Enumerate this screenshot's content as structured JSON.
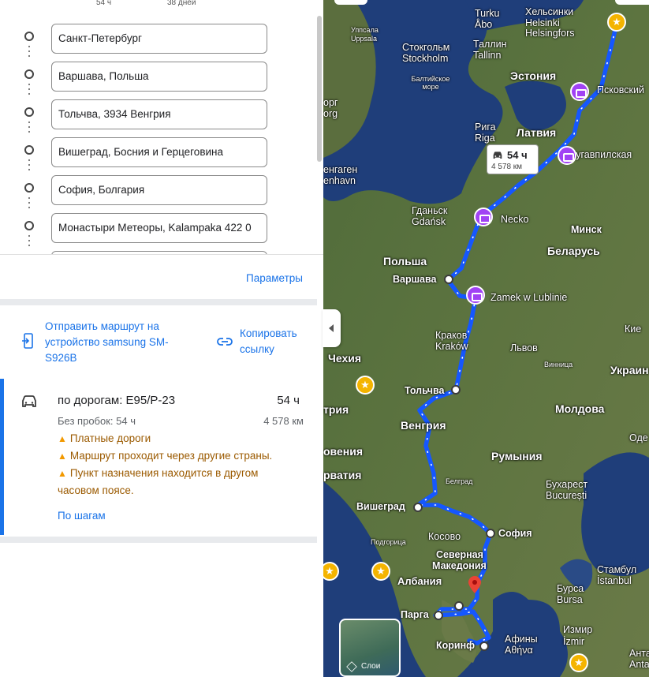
{
  "top_stats": {
    "duration": "54 ч",
    "days": "38 дней"
  },
  "stops": [
    "Санкт-Петербург",
    "Варшава, Польша",
    "Тольчва, 3934 Венгрия",
    "Вишеград, Босния и Герцеговина",
    "София, Болгария",
    "Монастыри Метеоры, Kalampaka 422 0"
  ],
  "parameters_link": "Параметры",
  "send_to_device": "Отправить маршрут на устройство samsung SM-S926B",
  "copy_link": "Копировать ссылку",
  "route": {
    "title": "по дорогам: E95/P-23",
    "duration": "54 ч",
    "traffic": "Без пробок: 54 ч",
    "distance": "4 578 км",
    "warnings": [
      "Платные дороги",
      "Маршрут проходит через другие страны.",
      "Пункт назначения находится в другом часовом поясе."
    ],
    "steps_link": "По шагам"
  },
  "map": {
    "bubble": {
      "time": "54 ч",
      "distance": "4 578 км"
    },
    "layers_label": "Слои",
    "labels": {
      "turku": "Turku",
      "abo": "Åbo",
      "helsinki_ru": "Хельсинки",
      "helsinki": "Helsinki",
      "helsingfors": "Helsingfors",
      "uppsala_ru": "Уппсала",
      "uppsala": "Uppsala",
      "stockholm_ru": "Стокгольм",
      "stockholm": "Stockholm",
      "tallinn_ru": "Таллин",
      "tallinn": "Tallinn",
      "baltic_sea": "Балтийское море",
      "estonia": "Эстония",
      "pskov": "Псковский",
      "org1": "орг",
      "org2": "org",
      "riga_ru": "Рига",
      "riga": "Riga",
      "latvia": "Латвия",
      "daugavpils": "Даугавпилская",
      "copenhagen_ru": "енгаген",
      "copenhagen": "enhavn",
      "gdansk_ru": "Гданьск",
      "gdansk": "Gdańsk",
      "necko": "Necko",
      "minsk": "Минск",
      "poland": "Польша",
      "belarus": "Беларусь",
      "warsaw": "Варшава",
      "lublin": "Zamek w Lublinie",
      "krakow_ru": "Краков",
      "krakow": "Kraków",
      "lviv": "Львов",
      "kiev": "Кие",
      "czechia": "Чехия",
      "vinnytsia": "Винница",
      "ukraine": "Украин",
      "tolcsva": "Тольчва",
      "austria": "трия",
      "hungary": "Венгрия",
      "moldova": "Молдова",
      "odessa": "Оде",
      "slovenia": "овения",
      "romania": "Румыния",
      "croatia": "рватия",
      "belgrade": "Белград",
      "bucharest_ru": "Бухарест",
      "bucharest": "București",
      "visegrad": "Вишеград",
      "sofia": "София",
      "kosovo": "Косово",
      "podgorica": "Подгорица",
      "n_macedonia_1": "Северная",
      "n_macedonia_2": "Македония",
      "albania": "Албания",
      "istanbul_ru": "Стамбул",
      "istanbul": "İstanbul",
      "bursa_ru": "Бурса",
      "bursa": "Bursa",
      "parga": "Парга",
      "izmir_ru": "Измир",
      "izmir": "İzmir",
      "athens_ru": "Афины",
      "athens": "Αθήνα",
      "corinth": "Коринф",
      "antalya_ru": "Анта",
      "antalya": "Anta"
    }
  }
}
